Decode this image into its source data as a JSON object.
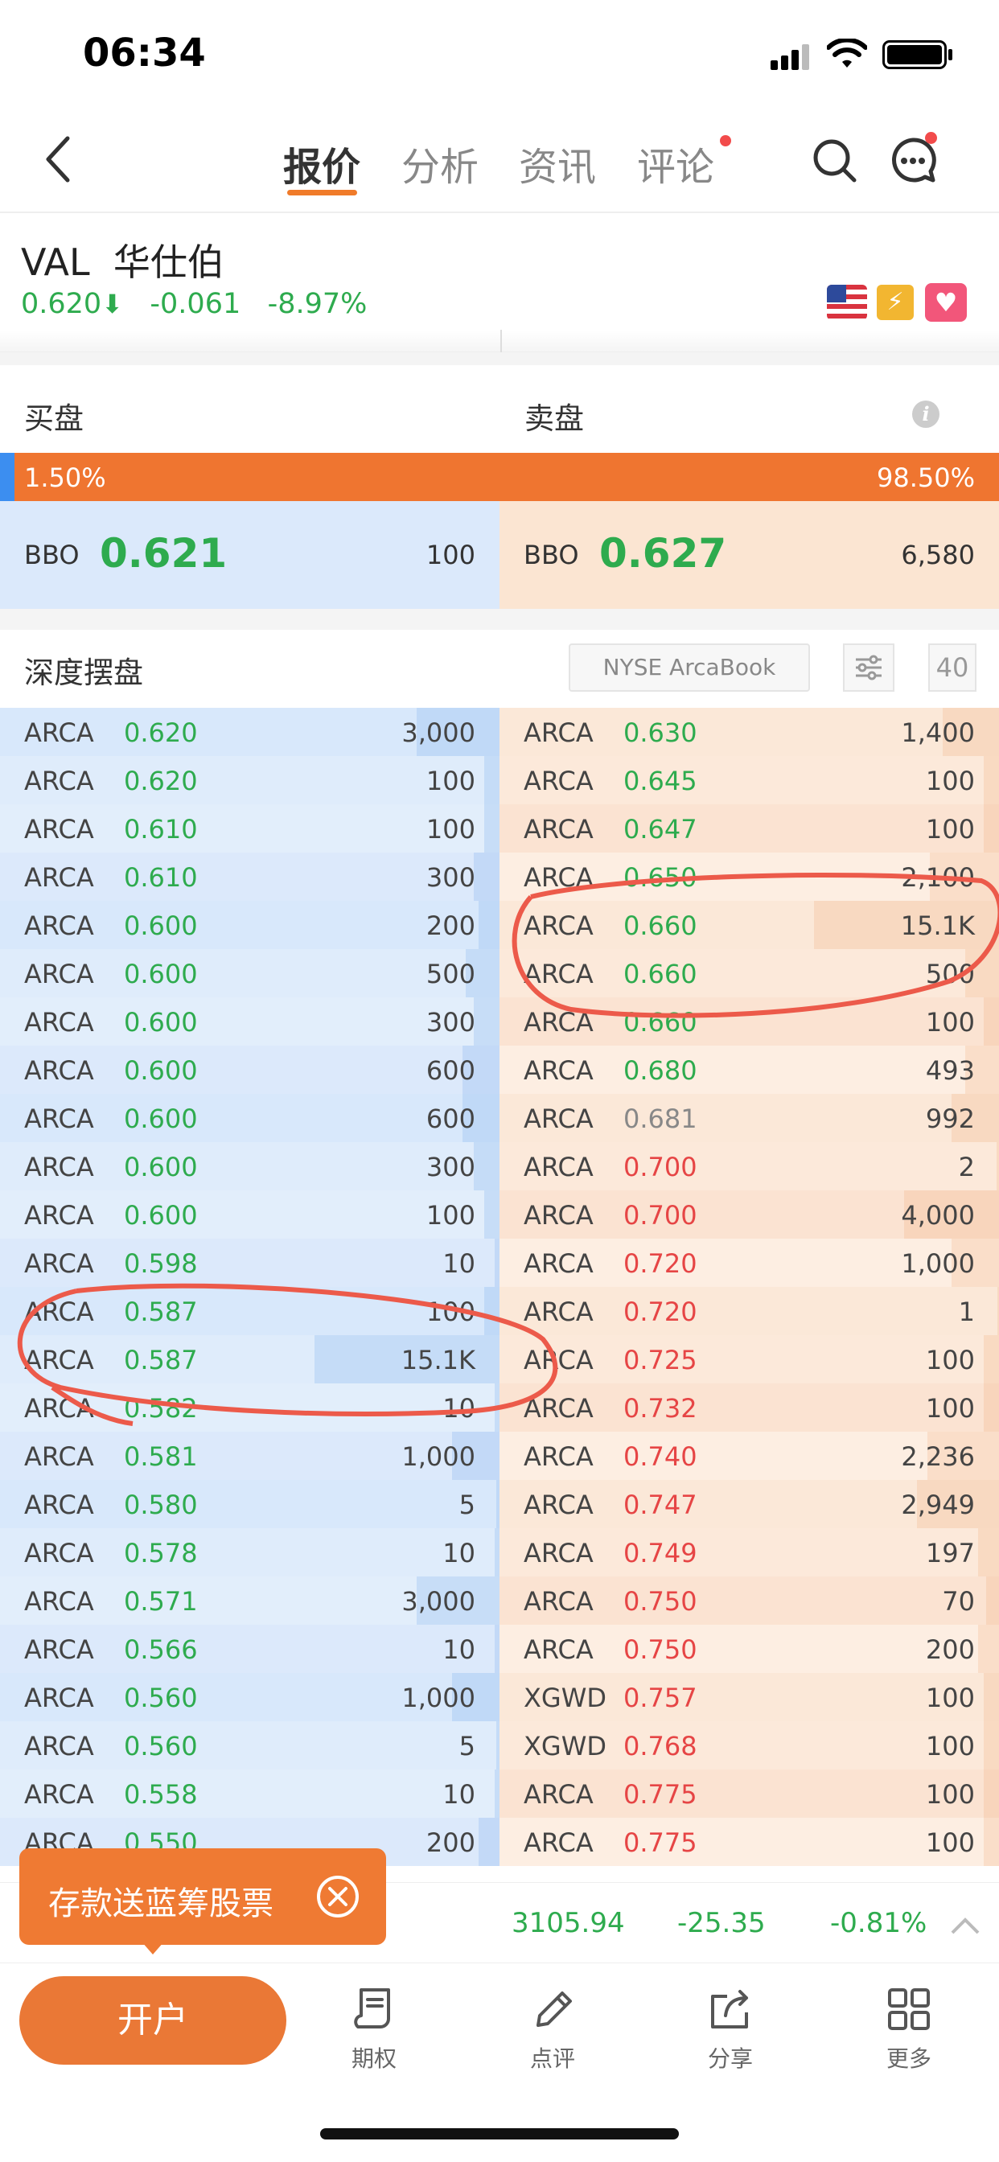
{
  "status": {
    "time": "06:34"
  },
  "nav": {
    "tabs": [
      {
        "label": "报价",
        "active": true
      },
      {
        "label": "分析"
      },
      {
        "label": "资讯"
      },
      {
        "label": "评论"
      }
    ]
  },
  "stock": {
    "symbol": "VAL",
    "name": "华仕伯",
    "price": "0.620",
    "change": "-0.061",
    "change_pct": "-8.97%"
  },
  "orderbook": {
    "bid_label": "买盘",
    "ask_label": "卖盘",
    "bid_pct": "1.50%",
    "ask_pct": "98.50%",
    "bbo_label": "BBO",
    "bbo_bid_price": "0.621",
    "bbo_bid_qty": "100",
    "bbo_ask_price": "0.627",
    "bbo_ask_qty": "6,580"
  },
  "depth": {
    "title": "深度摆盘",
    "source": "NYSE ArcaBook",
    "levels": "40",
    "bids": [
      {
        "ex": "ARCA",
        "price": "0.620",
        "qty": "3,000"
      },
      {
        "ex": "ARCA",
        "price": "0.620",
        "qty": "100"
      },
      {
        "ex": "ARCA",
        "price": "0.610",
        "qty": "100"
      },
      {
        "ex": "ARCA",
        "price": "0.610",
        "qty": "300"
      },
      {
        "ex": "ARCA",
        "price": "0.600",
        "qty": "200"
      },
      {
        "ex": "ARCA",
        "price": "0.600",
        "qty": "500"
      },
      {
        "ex": "ARCA",
        "price": "0.600",
        "qty": "300"
      },
      {
        "ex": "ARCA",
        "price": "0.600",
        "qty": "600"
      },
      {
        "ex": "ARCA",
        "price": "0.600",
        "qty": "600"
      },
      {
        "ex": "ARCA",
        "price": "0.600",
        "qty": "300"
      },
      {
        "ex": "ARCA",
        "price": "0.600",
        "qty": "100"
      },
      {
        "ex": "ARCA",
        "price": "0.598",
        "qty": "10"
      },
      {
        "ex": "ARCA",
        "price": "0.587",
        "qty": "100"
      },
      {
        "ex": "ARCA",
        "price": "0.587",
        "qty": "15.1K"
      },
      {
        "ex": "ARCA",
        "price": "0.582",
        "qty": "10"
      },
      {
        "ex": "ARCA",
        "price": "0.581",
        "qty": "1,000"
      },
      {
        "ex": "ARCA",
        "price": "0.580",
        "qty": "5"
      },
      {
        "ex": "ARCA",
        "price": "0.578",
        "qty": "10"
      },
      {
        "ex": "ARCA",
        "price": "0.571",
        "qty": "3,000"
      },
      {
        "ex": "ARCA",
        "price": "0.566",
        "qty": "10"
      },
      {
        "ex": "ARCA",
        "price": "0.560",
        "qty": "1,000"
      },
      {
        "ex": "ARCA",
        "price": "0.560",
        "qty": "5"
      },
      {
        "ex": "ARCA",
        "price": "0.558",
        "qty": "10"
      },
      {
        "ex": "ARCA",
        "price": "0.550",
        "qty": "200"
      }
    ],
    "asks": [
      {
        "ex": "ARCA",
        "price": "0.630",
        "qty": "1,400"
      },
      {
        "ex": "ARCA",
        "price": "0.645",
        "qty": "100"
      },
      {
        "ex": "ARCA",
        "price": "0.647",
        "qty": "100"
      },
      {
        "ex": "ARCA",
        "price": "0.650",
        "qty": "2,100"
      },
      {
        "ex": "ARCA",
        "price": "0.660",
        "qty": "15.1K"
      },
      {
        "ex": "ARCA",
        "price": "0.660",
        "qty": "500"
      },
      {
        "ex": "ARCA",
        "price": "0.660",
        "qty": "100"
      },
      {
        "ex": "ARCA",
        "price": "0.680",
        "qty": "493"
      },
      {
        "ex": "ARCA",
        "price": "0.681",
        "qty": "992"
      },
      {
        "ex": "ARCA",
        "price": "0.700",
        "qty": "2"
      },
      {
        "ex": "ARCA",
        "price": "0.700",
        "qty": "4,000"
      },
      {
        "ex": "ARCA",
        "price": "0.720",
        "qty": "1,000"
      },
      {
        "ex": "ARCA",
        "price": "0.720",
        "qty": "1"
      },
      {
        "ex": "ARCA",
        "price": "0.725",
        "qty": "100"
      },
      {
        "ex": "ARCA",
        "price": "0.732",
        "qty": "100"
      },
      {
        "ex": "ARCA",
        "price": "0.740",
        "qty": "2,236"
      },
      {
        "ex": "ARCA",
        "price": "0.747",
        "qty": "2,949"
      },
      {
        "ex": "ARCA",
        "price": "0.749",
        "qty": "197"
      },
      {
        "ex": "ARCA",
        "price": "0.750",
        "qty": "70"
      },
      {
        "ex": "ARCA",
        "price": "0.750",
        "qty": "200"
      },
      {
        "ex": "XGWD",
        "price": "0.757",
        "qty": "100"
      },
      {
        "ex": "XGWD",
        "price": "0.768",
        "qty": "100"
      },
      {
        "ex": "ARCA",
        "price": "0.775",
        "qty": "100"
      },
      {
        "ex": "ARCA",
        "price": "0.775",
        "qty": "100"
      }
    ]
  },
  "promo": {
    "text": "存款送蓝筹股票"
  },
  "index_ticker": {
    "value": "3105.94",
    "change": "-25.35",
    "pct": "-0.81%"
  },
  "tabbar": {
    "open_account": "开户",
    "items": [
      {
        "label": "期权",
        "icon": "receipt-icon"
      },
      {
        "label": "点评",
        "icon": "pencil-icon"
      },
      {
        "label": "分享",
        "icon": "share-icon"
      },
      {
        "label": "更多",
        "icon": "grid-icon"
      }
    ]
  },
  "colors": {
    "accent": "#f07b2a",
    "bid": "#dbe9fb",
    "ask": "#fbe9dc",
    "up_green": "#2eab4e",
    "down_red": "#e64545"
  }
}
